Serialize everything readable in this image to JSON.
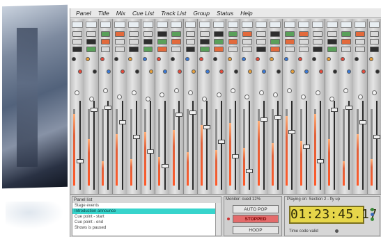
{
  "menu": [
    "Panel",
    "Title",
    "Mix",
    "Cue List",
    "Track List",
    "Group",
    "Status",
    "Help"
  ],
  "cue_panel": {
    "title": "Panel list",
    "rows": [
      "Stage events",
      "Introduction announce",
      "Cue point - start",
      "Cue point - end",
      "Shows is paused"
    ],
    "selected_index": 1
  },
  "transport": {
    "monitor_label": "Monitor: cued  12%",
    "buttons": [
      "AUTO POP",
      "STOPPED",
      "HOOP"
    ]
  },
  "time": {
    "playing_label": "Playing on:  Section 2 - fly up",
    "timecode": "01:23:45.17",
    "valid_label": "Time code valid"
  },
  "colors": {
    "cue_selected": "#38d4cc",
    "timecode_bg": "#e6d64a",
    "stopped": "#e46b6b",
    "meter": "#ff5a2a"
  }
}
